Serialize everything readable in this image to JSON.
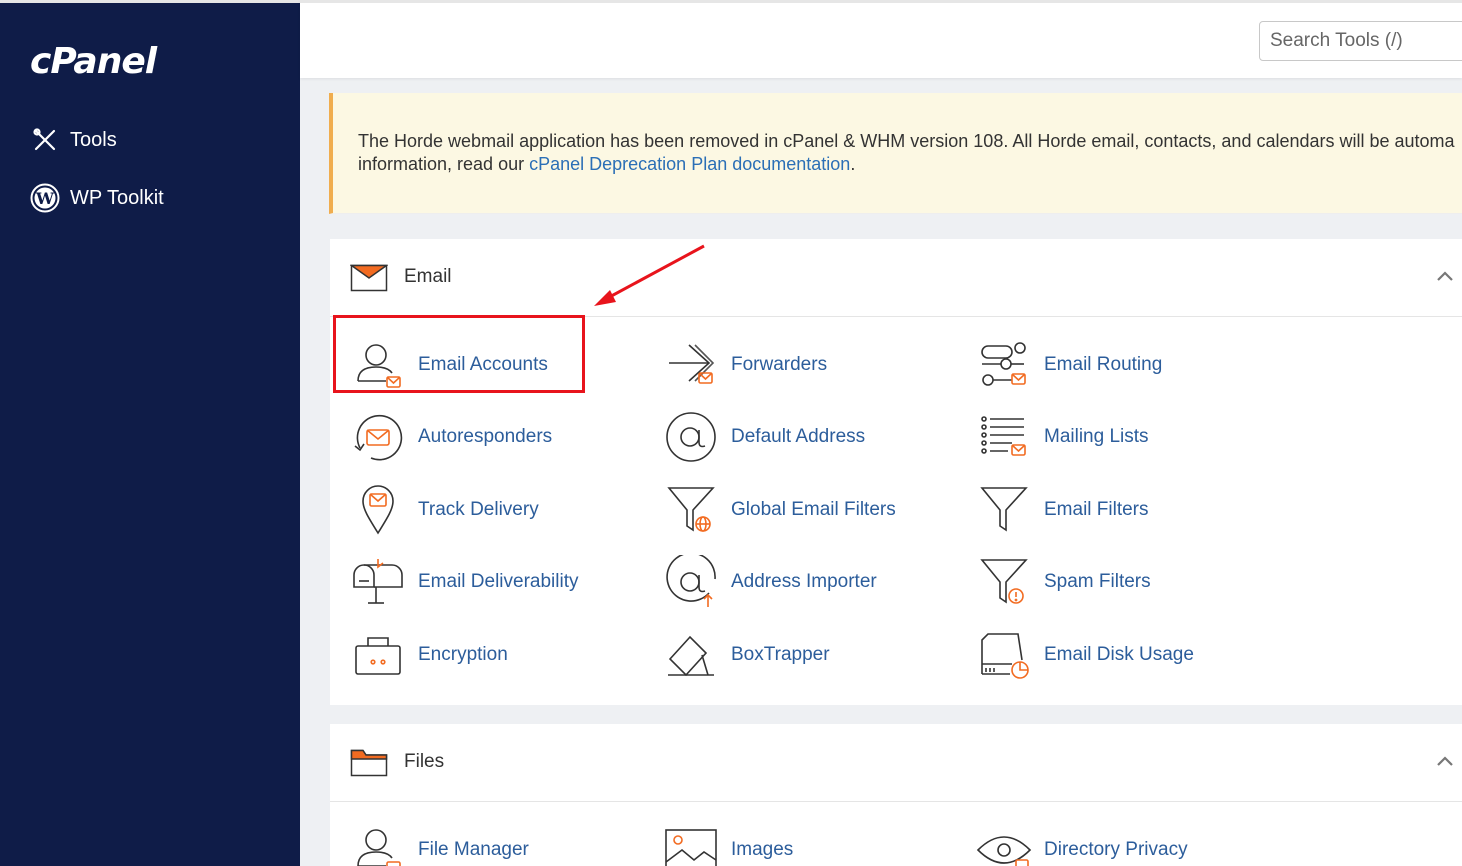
{
  "sidebar": {
    "logo": "cPanel",
    "items": [
      {
        "label": "Tools",
        "icon": "tools-icon"
      },
      {
        "label": "WP Toolkit",
        "icon": "wordpress-icon"
      }
    ]
  },
  "header": {
    "search_placeholder": "Search Tools (/)"
  },
  "notice": {
    "text_before": "The Horde webmail application has been removed in cPanel & WHM version 108. All Horde email, contacts, and calendars will be automa",
    "text_line2": "information, read our ",
    "link_text": "cPanel Deprecation Plan documentation",
    "text_after": "."
  },
  "email_section": {
    "title": "Email",
    "tools": [
      {
        "label": "Email Accounts",
        "icon": "email-accounts-icon"
      },
      {
        "label": "Forwarders",
        "icon": "forwarders-icon"
      },
      {
        "label": "Email Routing",
        "icon": "email-routing-icon"
      },
      {
        "label": "Autoresponders",
        "icon": "autoresponders-icon"
      },
      {
        "label": "Default Address",
        "icon": "default-address-icon"
      },
      {
        "label": "Mailing Lists",
        "icon": "mailing-lists-icon"
      },
      {
        "label": "Track Delivery",
        "icon": "track-delivery-icon"
      },
      {
        "label": "Global Email Filters",
        "icon": "global-email-filters-icon"
      },
      {
        "label": "Email Filters",
        "icon": "email-filters-icon"
      },
      {
        "label": "Email Deliverability",
        "icon": "email-deliverability-icon"
      },
      {
        "label": "Address Importer",
        "icon": "address-importer-icon"
      },
      {
        "label": "Spam Filters",
        "icon": "spam-filters-icon"
      },
      {
        "label": "Encryption",
        "icon": "encryption-icon"
      },
      {
        "label": "BoxTrapper",
        "icon": "boxtrapper-icon"
      },
      {
        "label": "Email Disk Usage",
        "icon": "email-disk-usage-icon"
      }
    ]
  },
  "files_section": {
    "title": "Files",
    "tools": [
      {
        "label": "File Manager",
        "icon": "file-manager-icon"
      },
      {
        "label": "Images",
        "icon": "images-icon"
      },
      {
        "label": "Directory Privacy",
        "icon": "directory-privacy-icon"
      }
    ]
  },
  "colors": {
    "sidebar_bg": "#0f1c48",
    "link": "#2c5d9b",
    "accent_orange": "#f26b21",
    "highlight_red": "#e8141c"
  }
}
